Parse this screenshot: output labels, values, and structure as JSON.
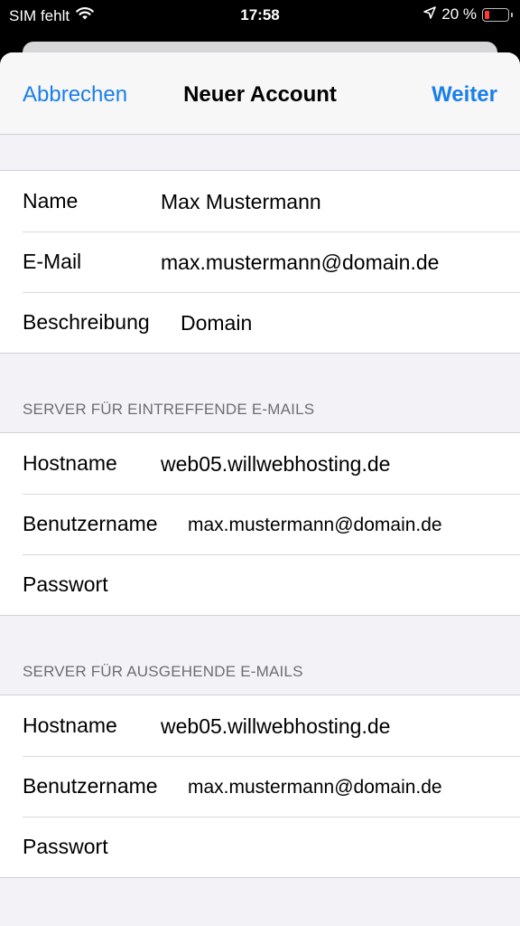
{
  "status_bar": {
    "carrier": "SIM fehlt",
    "time": "17:58",
    "battery_percent": "20 %",
    "battery_level": 0.2,
    "battery_color": "#ff3b30"
  },
  "nav": {
    "cancel_label": "Abbrechen",
    "title": "Neuer Account",
    "next_label": "Weiter",
    "accent_color": "#1a7fe8"
  },
  "account": {
    "name_label": "Name",
    "name_value": "Max Mustermann",
    "email_label": "E-Mail",
    "email_value": "max.mustermann@domain.de",
    "description_label": "Beschreibung",
    "description_value": "Domain"
  },
  "incoming": {
    "header": "SERVER FÜR EINTREFFENDE E-MAILS",
    "hostname_label": "Hostname",
    "hostname_value": "web05.willwebhosting.de",
    "username_label": "Benutzername",
    "username_value": "max.mustermann@domain.de",
    "password_label": "Passwort",
    "password_value": ""
  },
  "outgoing": {
    "header": "SERVER FÜR AUSGEHENDE E-MAILS",
    "hostname_label": "Hostname",
    "hostname_value": "web05.willwebhosting.de",
    "username_label": "Benutzername",
    "username_value": "max.mustermann@domain.de",
    "password_label": "Passwort",
    "password_value": ""
  }
}
